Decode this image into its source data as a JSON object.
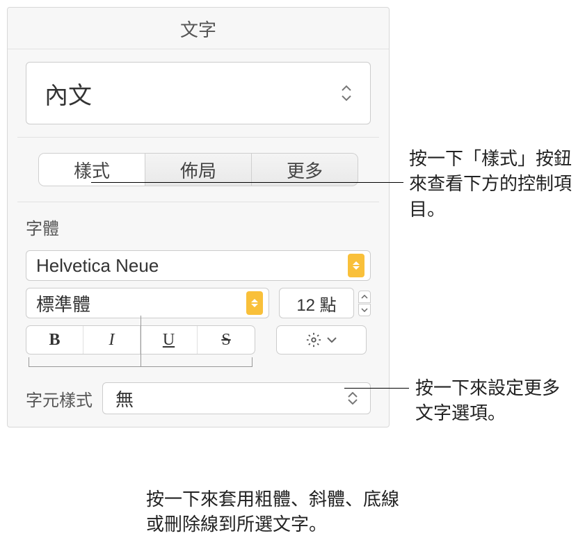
{
  "panel": {
    "title": "文字",
    "paragraph_style": "內文",
    "tabs": [
      "樣式",
      "佈局",
      "更多"
    ],
    "font_section_label": "字體",
    "font_family": "Helvetica Neue",
    "font_weight": "標準體",
    "font_size": "12 點",
    "format_buttons": {
      "bold": "B",
      "italic": "I",
      "underline": "U",
      "strike": "S"
    },
    "char_style_label": "字元樣式",
    "char_style_value": "無"
  },
  "callouts": {
    "style_tab": "按一下「樣式」按鈕來查看下方的控制項目。",
    "gear": "按一下來設定更多文字選項。",
    "format": "按一下來套用粗體、斜體、底線或刪除線到所選文字。"
  }
}
